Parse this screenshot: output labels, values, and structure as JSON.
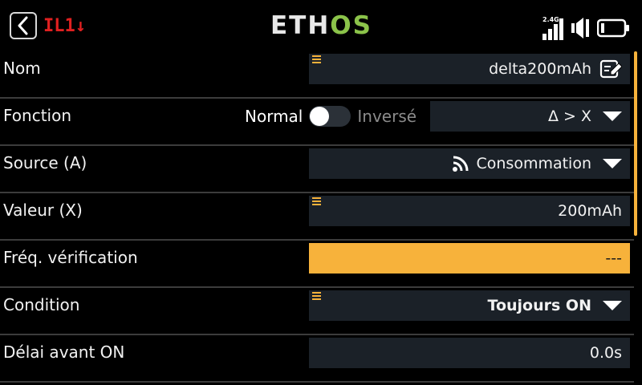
{
  "header": {
    "indicator": "IL1",
    "indicator_suffix": "↓",
    "logo_part1": "ETH",
    "logo_part2": "OS",
    "radio_band": "2.4G"
  },
  "rows": {
    "name": {
      "label": "Nom",
      "value": "delta200mAh"
    },
    "function": {
      "label": "Fonction",
      "switch_off_label": "Normal",
      "switch_on_label": "Inversé",
      "value": "Δ > X"
    },
    "source": {
      "label": "Source (A)",
      "value": "Consommation"
    },
    "value": {
      "label": "Valeur (X)",
      "value": "200mAh"
    },
    "check_freq": {
      "label": "Fréq. vérification",
      "value": "---"
    },
    "condition": {
      "label": "Condition",
      "value": "Toujours ON"
    },
    "delay": {
      "label": "Délai avant ON",
      "value": "0.0s"
    }
  },
  "colors": {
    "accent": "#f7b23b",
    "logo_green": "#8bc34a",
    "indicator_red": "#e02020",
    "field_bg": "#1b2128"
  }
}
